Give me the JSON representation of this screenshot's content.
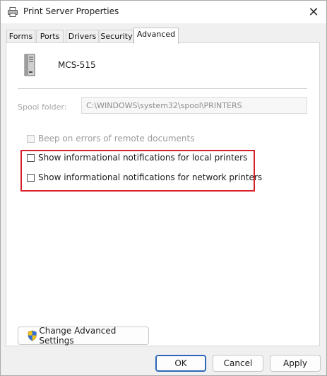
{
  "window": {
    "title": "Print Server Properties",
    "close": "✕"
  },
  "tabs": [
    {
      "label": "Forms"
    },
    {
      "label": "Ports"
    },
    {
      "label": "Drivers"
    },
    {
      "label": "Security"
    },
    {
      "label": "Advanced",
      "active": true
    }
  ],
  "advanced": {
    "server_name": "MCS-515",
    "spool_folder_label": "Spool folder:",
    "spool_folder_value": "C:\\WINDOWS\\system32\\spool\\PRINTERS",
    "options": [
      {
        "label": "Beep on errors of remote documents",
        "checked": false,
        "enabled": false
      },
      {
        "label": "Show informational notifications for local printers",
        "checked": false,
        "enabled": true
      },
      {
        "label": "Show informational notifications for network printers",
        "checked": false,
        "enabled": true
      }
    ],
    "change_settings_label": "Change Advanced Settings"
  },
  "buttons": {
    "ok": "OK",
    "cancel": "Cancel",
    "apply": "Apply"
  },
  "colors": {
    "highlight": "#d8202b",
    "default_button_border": "#2b66b8"
  }
}
